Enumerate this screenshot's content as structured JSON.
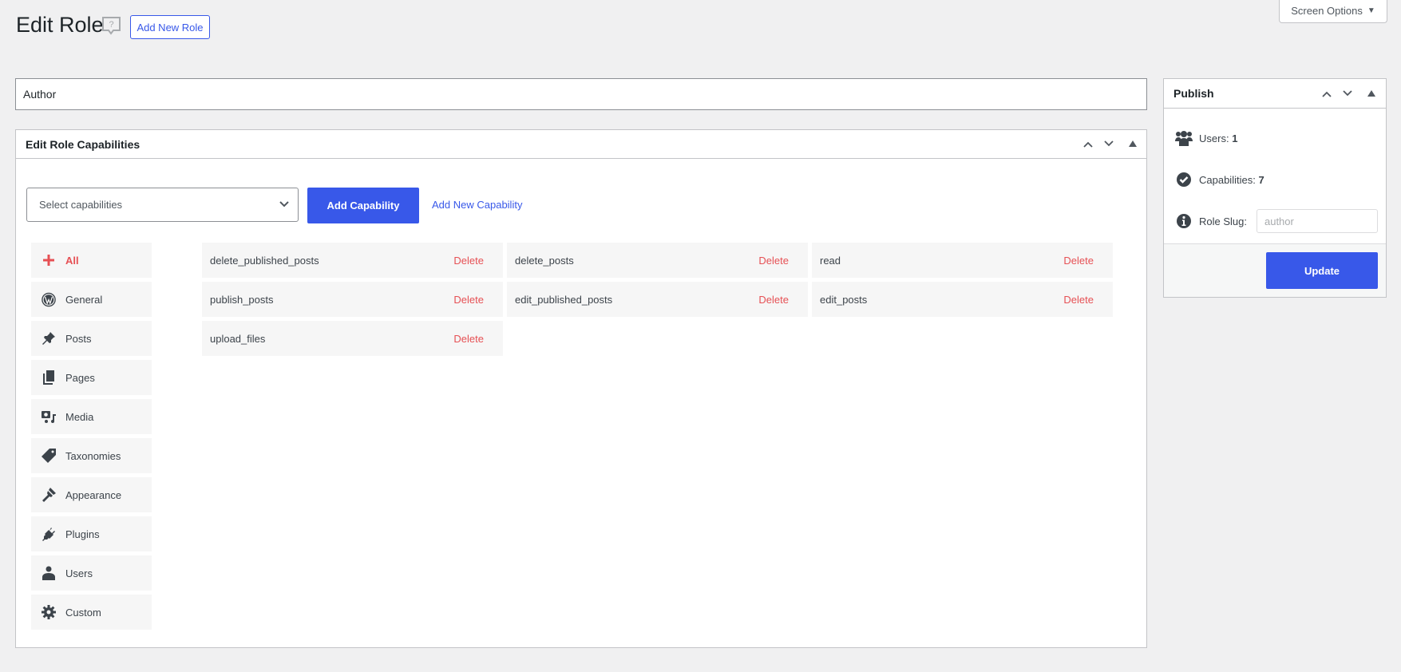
{
  "header": {
    "title": "Edit Role",
    "add_new_role": "Add New Role",
    "screen_options": "Screen Options"
  },
  "role_name": "Author",
  "capabilities_box": {
    "title": "Edit Role Capabilities",
    "select_placeholder": "Select capabilities",
    "add_capability": "Add Capability",
    "add_new_capability": "Add New Capability",
    "categories": [
      {
        "label": "All",
        "icon": "plus-icon",
        "active": true
      },
      {
        "label": "General",
        "icon": "wordpress-icon"
      },
      {
        "label": "Posts",
        "icon": "pushpin-icon"
      },
      {
        "label": "Pages",
        "icon": "pages-icon"
      },
      {
        "label": "Media",
        "icon": "media-icon"
      },
      {
        "label": "Taxonomies",
        "icon": "tag-icon"
      },
      {
        "label": "Appearance",
        "icon": "paintbrush-icon"
      },
      {
        "label": "Plugins",
        "icon": "plugin-icon"
      },
      {
        "label": "Users",
        "icon": "user-icon"
      },
      {
        "label": "Custom",
        "icon": "gear-icon"
      }
    ],
    "delete_label": "Delete",
    "capabilities": [
      "delete_published_posts",
      "delete_posts",
      "read",
      "publish_posts",
      "edit_published_posts",
      "edit_posts",
      "upload_files"
    ]
  },
  "publish": {
    "title": "Publish",
    "users_label": "Users:",
    "users_count": "1",
    "capabilities_label": "Capabilities:",
    "capabilities_count": "7",
    "slug_label": "Role Slug:",
    "slug_placeholder": "author",
    "update": "Update"
  },
  "colors": {
    "accent": "#3858e9",
    "delete": "#e65054",
    "background": "#f0f0f1"
  }
}
